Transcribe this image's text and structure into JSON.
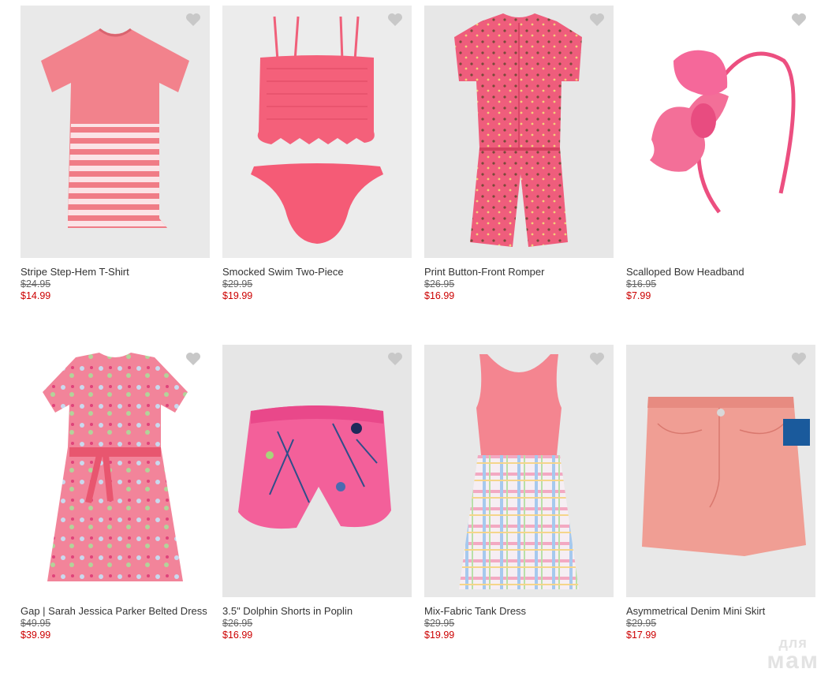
{
  "products": [
    {
      "name": "Stripe Step-Hem T-Shirt",
      "was": "$24.95",
      "now": "$14.99"
    },
    {
      "name": "Smocked Swim Two-Piece",
      "was": "$29.95",
      "now": "$19.99"
    },
    {
      "name": "Print Button-Front Romper",
      "was": "$26.95",
      "now": "$16.99"
    },
    {
      "name": "Scalloped Bow Headband",
      "was": "$16.95",
      "now": "$7.99"
    },
    {
      "name": "Gap | Sarah Jessica Parker Belted Dress",
      "was": "$49.95",
      "now": "$39.99"
    },
    {
      "name": "3.5\" Dolphin Shorts in Poplin",
      "was": "$26.95",
      "now": "$16.99"
    },
    {
      "name": "Mix-Fabric Tank Dress",
      "was": "$29.95",
      "now": "$19.99"
    },
    {
      "name": "Asymmetrical Denim Mini Skirt",
      "was": "$29.95",
      "now": "$17.99"
    }
  ],
  "icons": {
    "favorite": "heart-icon"
  },
  "colors": {
    "sale_price": "#cc0000",
    "swatch": "#1a5a9c",
    "tile_bg": "#ebebeb"
  },
  "watermark": {
    "line1": "для",
    "line2": "мам"
  }
}
